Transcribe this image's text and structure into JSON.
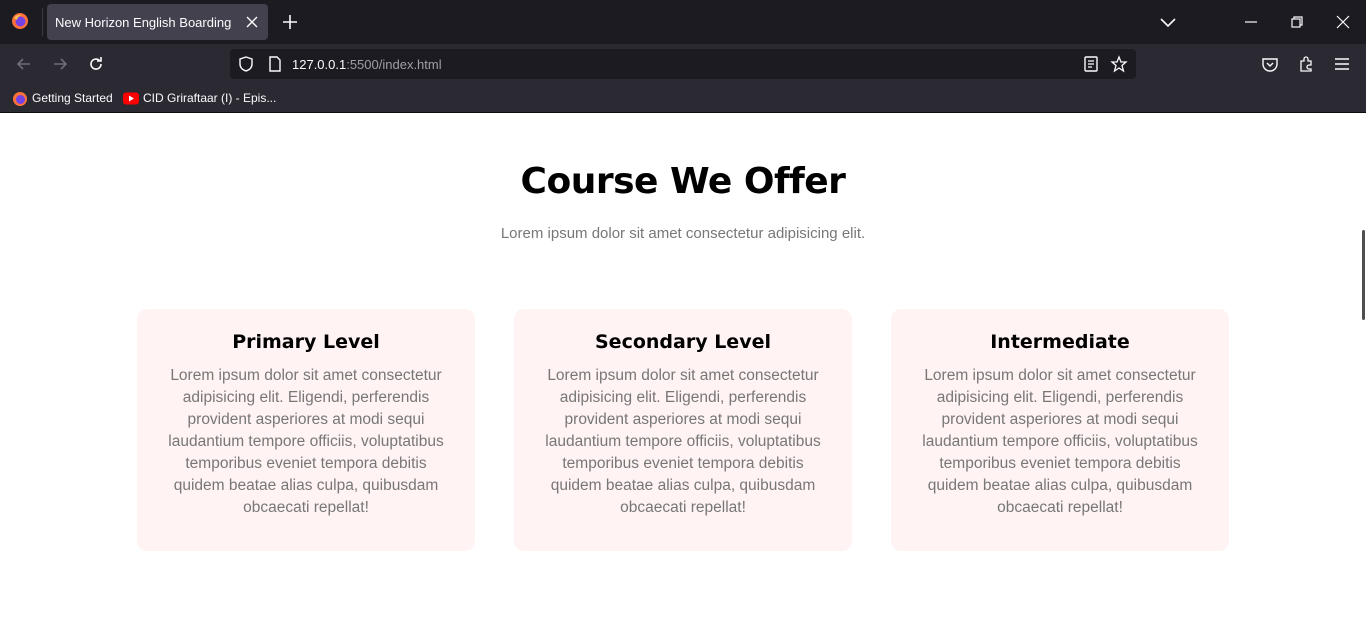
{
  "browser": {
    "tab_title": "New Horizon English Boarding",
    "url_host": "127.0.0.1",
    "url_rest": ":5500/index.html",
    "bookmarks": [
      {
        "label": "Getting Started",
        "icon": "firefox-icon"
      },
      {
        "label": "CID Griraftaar (I) - Epis...",
        "icon": "youtube-icon"
      }
    ]
  },
  "section": {
    "title": "Course We Offer",
    "subtitle": "Lorem ipsum dolor sit amet consectetur adipisicing elit."
  },
  "courses": [
    {
      "title": "Primary Level",
      "body": "Lorem ipsum dolor sit amet consectetur adipisicing elit. Eligendi, perferendis provident asperiores at modi sequi laudantium tempore officiis, voluptatibus temporibus eveniet tempora debitis quidem beatae alias culpa, quibusdam obcaecati repellat!"
    },
    {
      "title": "Secondary Level",
      "body": "Lorem ipsum dolor sit amet consectetur adipisicing elit. Eligendi, perferendis provident asperiores at modi sequi laudantium tempore officiis, voluptatibus temporibus eveniet tempora debitis quidem beatae alias culpa, quibusdam obcaecati repellat!"
    },
    {
      "title": "Intermediate",
      "body": "Lorem ipsum dolor sit amet consectetur adipisicing elit. Eligendi, perferendis provident asperiores at modi sequi laudantium tempore officiis, voluptatibus temporibus eveniet tempora debitis quidem beatae alias culpa, quibusdam obcaecati repellat!"
    }
  ],
  "colors": {
    "card_bg": "#fff3f3",
    "chrome_dark": "#1c1b22",
    "chrome_mid": "#2b2a33"
  }
}
